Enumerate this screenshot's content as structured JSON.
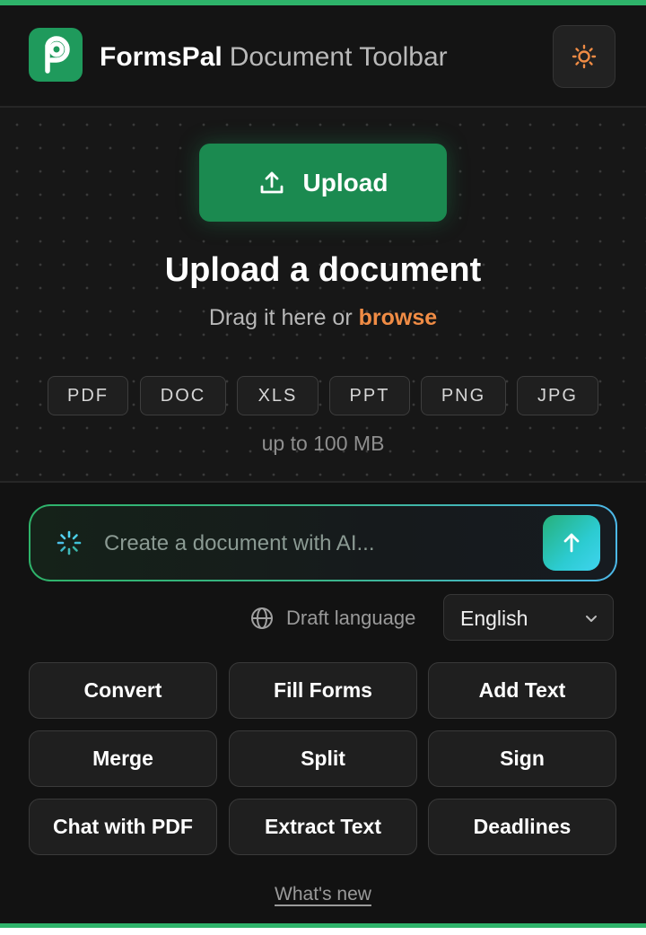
{
  "header": {
    "brand_name": "FormsPal",
    "brand_subtitle": "Document Toolbar",
    "logo_icon": "formspal-logo-icon",
    "theme_toggle_icon": "sun-icon"
  },
  "upload": {
    "button_label": "Upload",
    "button_icon": "upload-icon",
    "title": "Upload a document",
    "subtitle_prefix": "Drag it here or",
    "browse_link": "browse",
    "formats": [
      "PDF",
      "DOC",
      "XLS",
      "PPT",
      "PNG",
      "JPG"
    ],
    "size_limit": "up to 100 MB"
  },
  "ai": {
    "placeholder": "Create a document with AI...",
    "spinner_icon": "loading-spinner-icon",
    "send_icon": "arrow-up-icon"
  },
  "language": {
    "label": "Draft language",
    "selected": "English",
    "globe_icon": "globe-icon"
  },
  "actions": [
    "Convert",
    "Fill Forms",
    "Add Text",
    "Merge",
    "Split",
    "Sign",
    "Chat with PDF",
    "Extract Text",
    "Deadlines"
  ],
  "footer": {
    "whats_new": "What's new"
  },
  "colors": {
    "accent_green": "#1b8a50",
    "browse_orange": "#f08c45",
    "sun_orange": "#f08c45",
    "background": "#121212",
    "gradient_cyan": "#3fd4ef"
  }
}
